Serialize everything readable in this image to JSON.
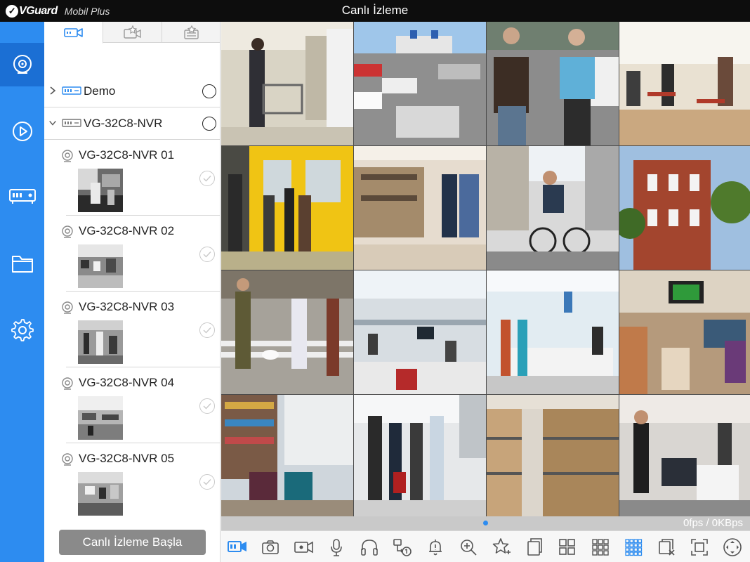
{
  "app": {
    "brand_logo": "VGuard",
    "brand_sub": "Mobil Plus",
    "title": "Canlı İzleme"
  },
  "colors": {
    "accent": "#2d8cf0",
    "topbar": "#0d0d0d",
    "button_gray": "#8a8a8a"
  },
  "rail": {
    "items": [
      {
        "icon": "live-camera-icon",
        "active": true
      },
      {
        "icon": "playback-icon",
        "active": false
      },
      {
        "icon": "device-manager-icon",
        "active": false
      },
      {
        "icon": "folder-icon",
        "active": false
      },
      {
        "icon": "settings-gear-icon",
        "active": false
      }
    ]
  },
  "panel": {
    "tabs": [
      {
        "icon": "device-list-icon",
        "active": true
      },
      {
        "icon": "favorites-icon",
        "active": false
      },
      {
        "icon": "favorite-groups-icon",
        "active": false
      }
    ],
    "groups": [
      {
        "name": "Demo",
        "expanded": false
      },
      {
        "name": "VG-32C8-NVR",
        "expanded": true
      }
    ],
    "cameras": [
      {
        "name": "VG-32C8-NVR 01"
      },
      {
        "name": "VG-32C8-NVR 02"
      },
      {
        "name": "VG-32C8-NVR 03"
      },
      {
        "name": "VG-32C8-NVR 04"
      },
      {
        "name": "VG-32C8-NVR 05"
      }
    ],
    "start_button": "Canlı İzleme Başla"
  },
  "grid": {
    "columns": 4,
    "rows": 4,
    "tiles": [
      {
        "scene": "shopping-cart-store"
      },
      {
        "scene": "parking-lot"
      },
      {
        "scene": "students-walking"
      },
      {
        "scene": "cafe-terrace"
      },
      {
        "scene": "subway-platform"
      },
      {
        "scene": "clothing-store"
      },
      {
        "scene": "cyclist-street"
      },
      {
        "scene": "brick-building"
      },
      {
        "scene": "city-crosswalk"
      },
      {
        "scene": "open-office"
      },
      {
        "scene": "reception-desk"
      },
      {
        "scene": "lounge-tv"
      },
      {
        "scene": "bookshop-cafe"
      },
      {
        "scene": "airport-travelers"
      },
      {
        "scene": "warehouse-shelves"
      },
      {
        "scene": "call-center"
      }
    ]
  },
  "status": {
    "fps_text": "0fps / 0KBps"
  },
  "toolbar": {
    "buttons": [
      {
        "icon": "live-view-icon",
        "active": true
      },
      {
        "icon": "snapshot-camera-icon",
        "active": false
      },
      {
        "icon": "record-icon",
        "active": false
      },
      {
        "icon": "microphone-icon",
        "active": false
      },
      {
        "icon": "headphones-icon",
        "active": false
      },
      {
        "icon": "stream-switch-icon",
        "active": false
      },
      {
        "icon": "alarm-bell-icon",
        "active": false
      },
      {
        "icon": "zoom-in-icon",
        "active": false
      },
      {
        "icon": "add-favorite-icon",
        "active": false
      },
      {
        "icon": "multi-window-icon",
        "active": false
      },
      {
        "icon": "layout-4-icon",
        "active": false
      },
      {
        "icon": "layout-9-icon",
        "active": false
      },
      {
        "icon": "layout-16-icon",
        "active": true
      },
      {
        "icon": "close-all-icon",
        "active": false
      },
      {
        "icon": "fullscreen-icon",
        "active": false
      },
      {
        "icon": "ptz-control-icon",
        "active": false
      }
    ]
  }
}
